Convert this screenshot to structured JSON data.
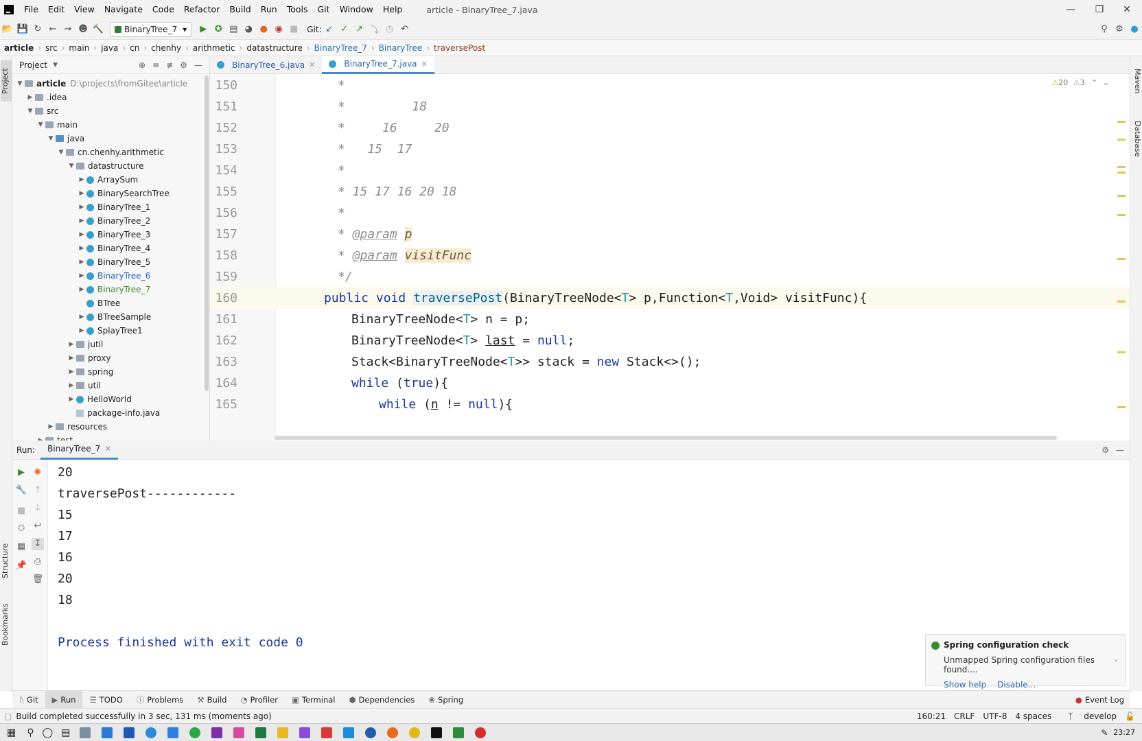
{
  "menu": {
    "items": [
      "File",
      "Edit",
      "View",
      "Navigate",
      "Code",
      "Refactor",
      "Build",
      "Run",
      "Tools",
      "Git",
      "Window",
      "Help"
    ],
    "window_title": "article - BinaryTree_7.java"
  },
  "toolbar": {
    "run_config": "BinaryTree_7",
    "git_label": "Git:"
  },
  "breadcrumb": [
    "article",
    "src",
    "main",
    "java",
    "cn",
    "chenhy",
    "arithmetic",
    "datastructure",
    "BinaryTree_7",
    "BinaryTree",
    "traversePost"
  ],
  "left_strip": {
    "project": "Project",
    "structure": "Structure",
    "bookmarks": "Bookmarks"
  },
  "right_strip": {
    "maven": "Maven",
    "database": "Database"
  },
  "project_panel": {
    "title": "Project",
    "root_name": "article",
    "root_path": "D:\\projects\\fromGitee\\article",
    "items": [
      {
        "label": ".idea",
        "depth": 1,
        "type": "folder",
        "expanded": false
      },
      {
        "label": "src",
        "depth": 1,
        "type": "folder",
        "expanded": true
      },
      {
        "label": "main",
        "depth": 2,
        "type": "folder",
        "expanded": true
      },
      {
        "label": "java",
        "depth": 3,
        "type": "src",
        "expanded": true
      },
      {
        "label": "cn.chenhy.arithmetic",
        "depth": 4,
        "type": "folder",
        "expanded": true
      },
      {
        "label": "datastructure",
        "depth": 5,
        "type": "folder",
        "expanded": true
      },
      {
        "label": "ArraySum",
        "depth": 6,
        "type": "class",
        "expanded": false
      },
      {
        "label": "BinarySearchTree",
        "depth": 6,
        "type": "class",
        "expanded": false
      },
      {
        "label": "BinaryTree_1",
        "depth": 6,
        "type": "class",
        "expanded": false
      },
      {
        "label": "BinaryTree_2",
        "depth": 6,
        "type": "class",
        "expanded": false
      },
      {
        "label": "BinaryTree_3",
        "depth": 6,
        "type": "class",
        "expanded": false
      },
      {
        "label": "BinaryTree_4",
        "depth": 6,
        "type": "class",
        "expanded": false
      },
      {
        "label": "BinaryTree_5",
        "depth": 6,
        "type": "class",
        "expanded": false
      },
      {
        "label": "BinaryTree_6",
        "depth": 6,
        "type": "class",
        "expanded": false,
        "color": "blue"
      },
      {
        "label": "BinaryTree_7",
        "depth": 6,
        "type": "class",
        "expanded": false,
        "color": "green"
      },
      {
        "label": "BTree",
        "depth": 6,
        "type": "class",
        "leaf": true
      },
      {
        "label": "BTreeSample",
        "depth": 6,
        "type": "class",
        "expanded": false
      },
      {
        "label": "SplayTree1",
        "depth": 6,
        "type": "class",
        "expanded": false
      },
      {
        "label": "jutil",
        "depth": 5,
        "type": "folder",
        "expanded": false
      },
      {
        "label": "proxy",
        "depth": 5,
        "type": "folder",
        "expanded": false
      },
      {
        "label": "spring",
        "depth": 5,
        "type": "folder",
        "expanded": false
      },
      {
        "label": "util",
        "depth": 5,
        "type": "folder",
        "expanded": false
      },
      {
        "label": "HelloWorld",
        "depth": 5,
        "type": "class",
        "expanded": false
      },
      {
        "label": "package-info.java",
        "depth": 5,
        "type": "file",
        "leaf": true
      },
      {
        "label": "resources",
        "depth": 3,
        "type": "folder",
        "expanded": false
      },
      {
        "label": "test",
        "depth": 2,
        "type": "folder",
        "expanded": false
      }
    ]
  },
  "editor": {
    "tabs": [
      {
        "label": "BinaryTree_6.java",
        "active": false
      },
      {
        "label": "BinaryTree_7.java",
        "active": true
      }
    ],
    "warnings": "20",
    "weak_warnings": "3"
  },
  "run": {
    "label": "Run:",
    "tab": "BinaryTree_7",
    "output": [
      "20",
      "traversePost------------",
      "15",
      "17",
      "16",
      "20",
      "18",
      "",
      "Process finished with exit code 0"
    ]
  },
  "notification": {
    "title": "Spring configuration check",
    "body": "Unmapped Spring configuration files found....",
    "link1": "Show help",
    "link2": "Disable..."
  },
  "tool_windows": [
    "Git",
    "Run",
    "TODO",
    "Problems",
    "Build",
    "Profiler",
    "Terminal",
    "Dependencies",
    "Spring"
  ],
  "event_log": "Event Log",
  "status": {
    "message": "Build completed successfully in 3 sec, 131 ms (moments ago)",
    "position": "160:21",
    "line_sep": "CRLF",
    "encoding": "UTF-8",
    "indent": "4 spaces",
    "branch": "develop"
  },
  "taskbar": {
    "time": "23:27"
  },
  "colors": {
    "accent": "#4a88c7",
    "keyword": "#1a37a0",
    "comment": "#8c8c8c",
    "success": "#3d8a2e"
  }
}
